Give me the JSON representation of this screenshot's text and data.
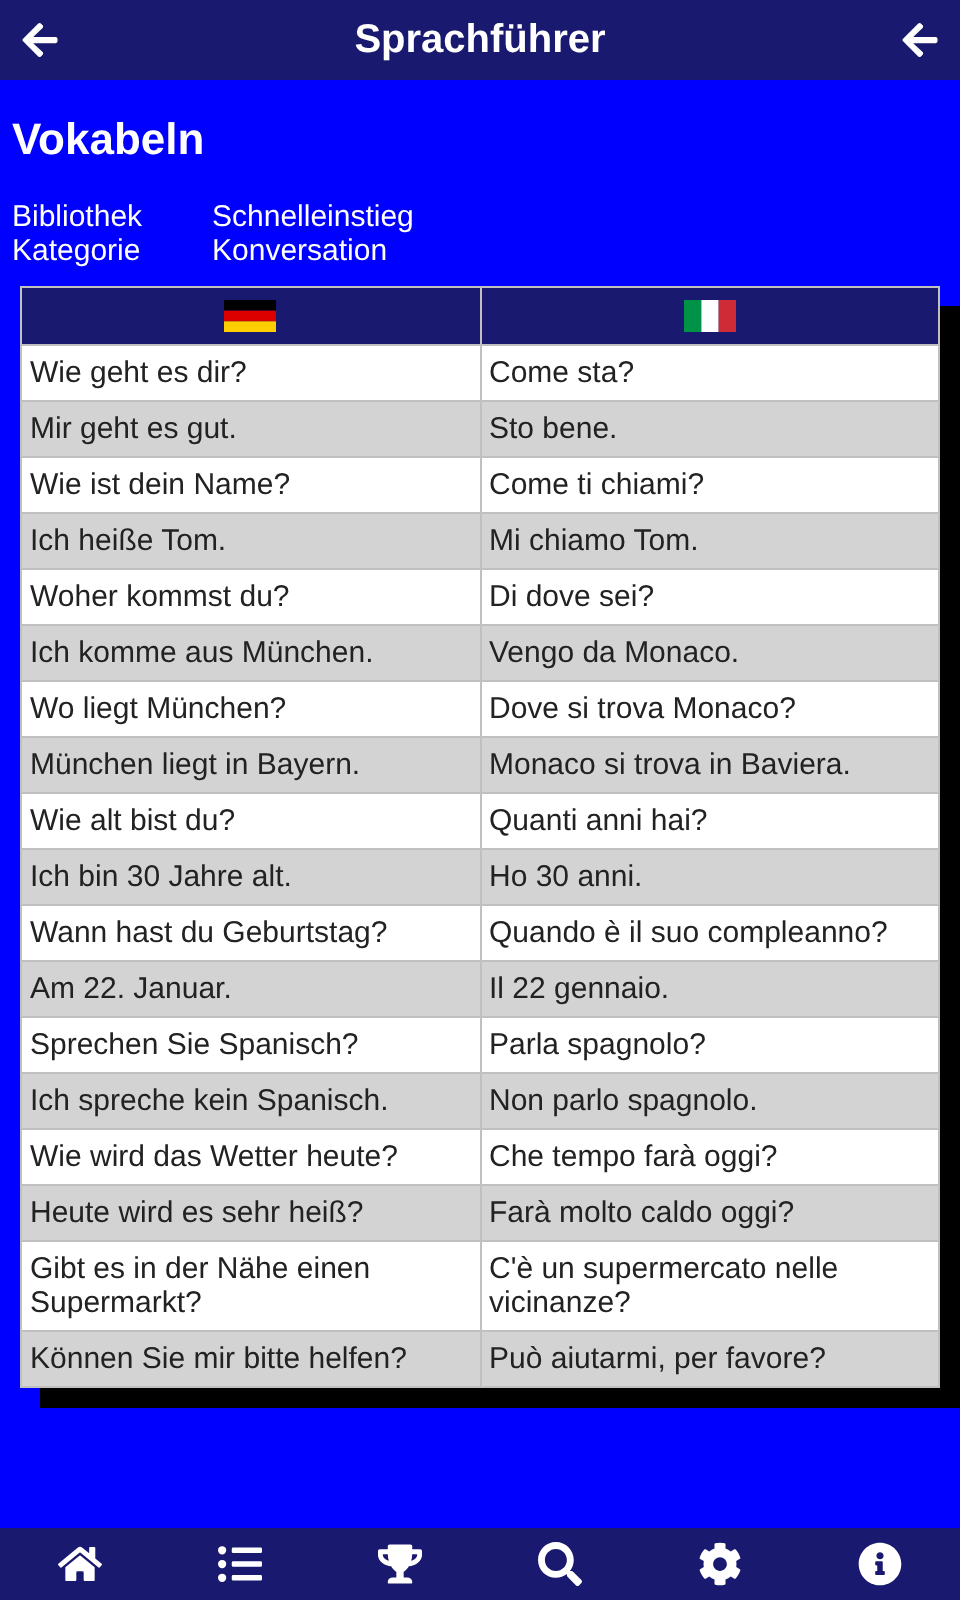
{
  "app_bar": {
    "title": "Sprachführer"
  },
  "heading": "Vokabeln",
  "info": [
    {
      "label": "Bibliothek",
      "value": "Schnelleinstieg"
    },
    {
      "label": "Kategorie",
      "value": "Konversation"
    }
  ],
  "table": {
    "rows": [
      [
        "Wie geht es dir?",
        "Come sta?"
      ],
      [
        "Mir geht es gut.",
        "Sto bene."
      ],
      [
        "Wie ist dein Name?",
        "Come ti chiami?"
      ],
      [
        "Ich heiße Tom.",
        "Mi chiamo Tom."
      ],
      [
        "Woher kommst du?",
        "Di dove sei?"
      ],
      [
        "Ich komme aus München.",
        "Vengo da Monaco."
      ],
      [
        "Wo liegt München?",
        "Dove si trova Monaco?"
      ],
      [
        "München liegt in Bayern.",
        "Monaco si trova in Baviera."
      ],
      [
        "Wie alt bist du?",
        "Quanti anni hai?"
      ],
      [
        "Ich bin 30 Jahre alt.",
        "Ho 30 anni."
      ],
      [
        "Wann hast du Geburtstag?",
        "Quando è il suo compleanno?"
      ],
      [
        "Am 22. Januar.",
        "Il 22 gennaio."
      ],
      [
        "Sprechen Sie Spanisch?",
        "Parla spagnolo?"
      ],
      [
        "Ich spreche kein Spanisch.",
        "Non parlo spagnolo."
      ],
      [
        "Wie wird das Wetter heute?",
        "Che tempo farà oggi?"
      ],
      [
        "Heute wird es sehr heiß?",
        "Farà molto caldo oggi?"
      ],
      [
        "Gibt es in der Nähe einen Supermarkt?",
        "C'è un supermercato nelle vicinanze?"
      ],
      [
        "Können Sie mir bitte helfen?",
        "Può aiutarmi, per favore?"
      ]
    ]
  }
}
